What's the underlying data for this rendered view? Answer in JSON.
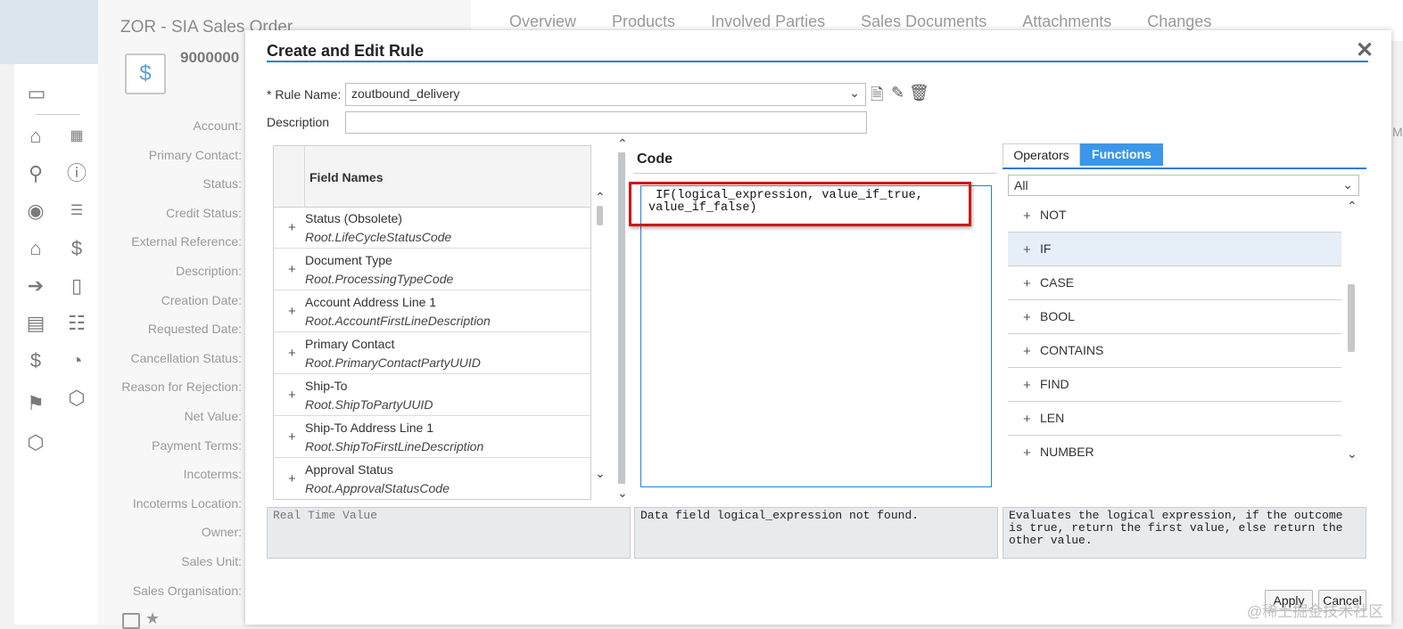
{
  "background": {
    "object_title": "ZOR - SIA Sales Order",
    "object_id": "9000000",
    "tabs": [
      "Overview",
      "Products",
      "Involved Parties",
      "Sales Documents",
      "Attachments",
      "Changes"
    ],
    "field_labels": [
      "Account:",
      "Primary Contact:",
      "Status:",
      "Credit Status:",
      "External Reference:",
      "Description:",
      "Creation Date:",
      "Requested Date:",
      "Cancellation Status:",
      "Reason for Rejection:",
      "Net Value:",
      "Payment Terms:",
      "Incoterms:",
      "Incoterms Location:",
      "Owner:",
      "Sales Unit:",
      "Sales Organisation:"
    ],
    "sidebar_icons": [
      "chat-icon",
      "home-icon",
      "calendar-icon",
      "search-icon",
      "alert-icon",
      "person-icon",
      "contact-list-icon",
      "org-chart-icon",
      "currency-icon",
      "transfer-icon",
      "notebook-icon",
      "quote-icon",
      "list-icon",
      "invoice-icon",
      "chart-icon",
      "map-icon",
      "box-icon",
      "package-icon"
    ],
    "edge_letter": "M"
  },
  "dialog": {
    "title": "Create and Edit Rule",
    "close_label": "✕",
    "rule_name_label": "* Rule Name:",
    "rule_name_value": "zoutbound_delivery",
    "description_label": "Description",
    "description_value": "",
    "field_names_header": "Field Names",
    "fields": [
      {
        "name": "Status (Obsolete)",
        "path": "Root.LifeCycleStatusCode"
      },
      {
        "name": "Document Type",
        "path": "Root.ProcessingTypeCode"
      },
      {
        "name": "Account Address Line 1",
        "path": "Root.AccountFirstLineDescription"
      },
      {
        "name": "Primary Contact",
        "path": "Root.PrimaryContactPartyUUID"
      },
      {
        "name": "Ship-To",
        "path": "Root.ShipToPartyUUID"
      },
      {
        "name": "Ship-To Address Line 1",
        "path": "Root.ShipToFirstLineDescription"
      },
      {
        "name": "Approval Status",
        "path": "Root.ApprovalStatusCode"
      }
    ],
    "code_title": "Code",
    "code_text": " IF(logical_expression, value_if_true,\nvalue_if_false)",
    "tabs": {
      "operators": "Operators",
      "functions": "Functions"
    },
    "function_filter": "All",
    "functions": [
      "NOT",
      "IF",
      "CASE",
      "BOOL",
      "CONTAINS",
      "FIND",
      "LEN",
      "NUMBER"
    ],
    "selected_function": "IF",
    "real_time_value_placeholder": "Real Time Value",
    "validation_message": "Data field logical_expression not found.",
    "function_description": "Evaluates the logical expression, if the outcome is true, return the first value, else return the other value.",
    "apply_label": "Apply",
    "cancel_label": "Cancel"
  },
  "watermark": "@稀土掘金技术社区",
  "colors": {
    "accent": "#2b7dd6",
    "tab_active": "#3c97e8",
    "highlight_box": "#d01717"
  }
}
